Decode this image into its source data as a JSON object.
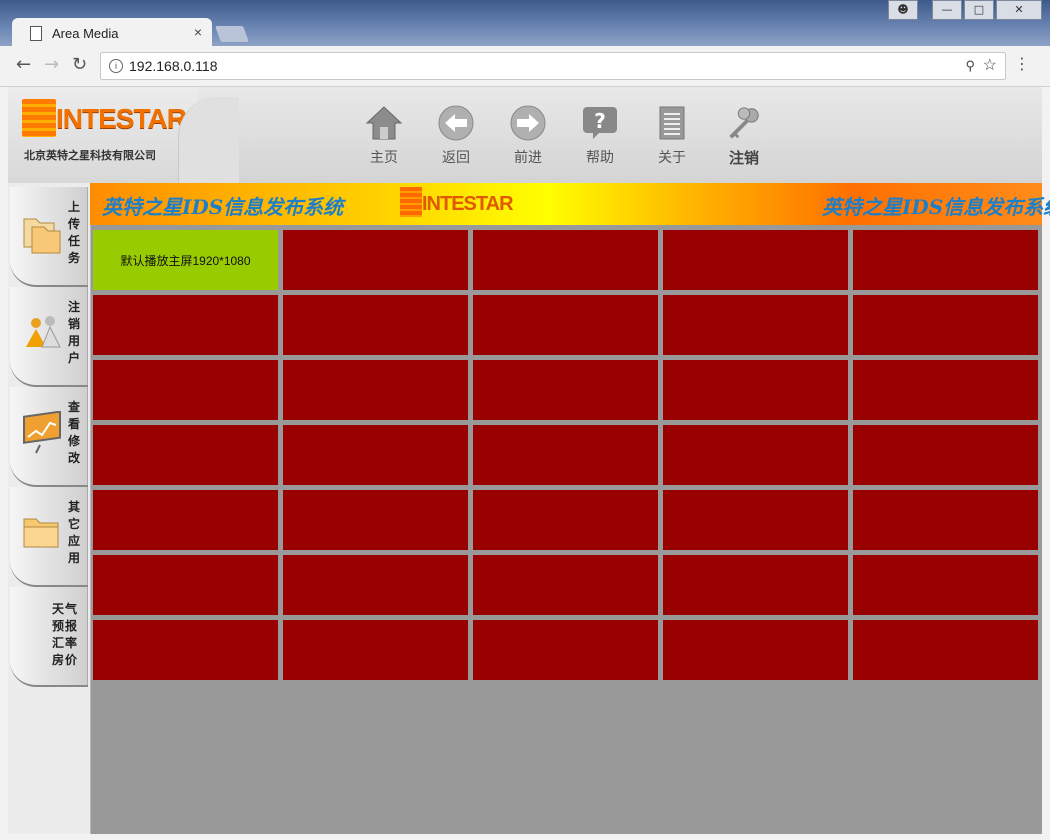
{
  "browser": {
    "tab_title": "Area Media",
    "tab_close": "×",
    "url": "192.168.0.118",
    "win_controls": [
      "",
      "▭",
      "▢",
      "✕"
    ]
  },
  "header": {
    "logo_text": "INTESTAR",
    "logo_subtitle": "北京英特之星科技有限公司",
    "toolbar": [
      {
        "label": "主页",
        "icon": "home-icon"
      },
      {
        "label": "返回",
        "icon": "back-arrow-icon"
      },
      {
        "label": "前进",
        "icon": "forward-arrow-icon"
      },
      {
        "label": "帮助",
        "icon": "help-icon"
      },
      {
        "label": "关于",
        "icon": "document-icon"
      },
      {
        "label": "注销",
        "icon": "keys-icon"
      }
    ]
  },
  "sidebar": {
    "items": [
      {
        "label": "上传任务",
        "icon": "folders-icon"
      },
      {
        "label": "注销用户",
        "icon": "users-icon"
      },
      {
        "label": "查看修改",
        "icon": "monitor-chart-icon"
      },
      {
        "label": "其它应用",
        "icon": "folder-icon"
      },
      {
        "label": "天气预报汇率房价",
        "icon": ""
      }
    ]
  },
  "banner": {
    "title": "英特之星IDS信息发布系统",
    "title_repeat": "英特之星IDS信息发布系统",
    "logo_text": "INTESTAR"
  },
  "grid": {
    "rows": 7,
    "cols": 5,
    "cells": [
      "默认播放主屏1920*1080"
    ],
    "active_color": "#99cc00",
    "inactive_color": "#990000"
  }
}
